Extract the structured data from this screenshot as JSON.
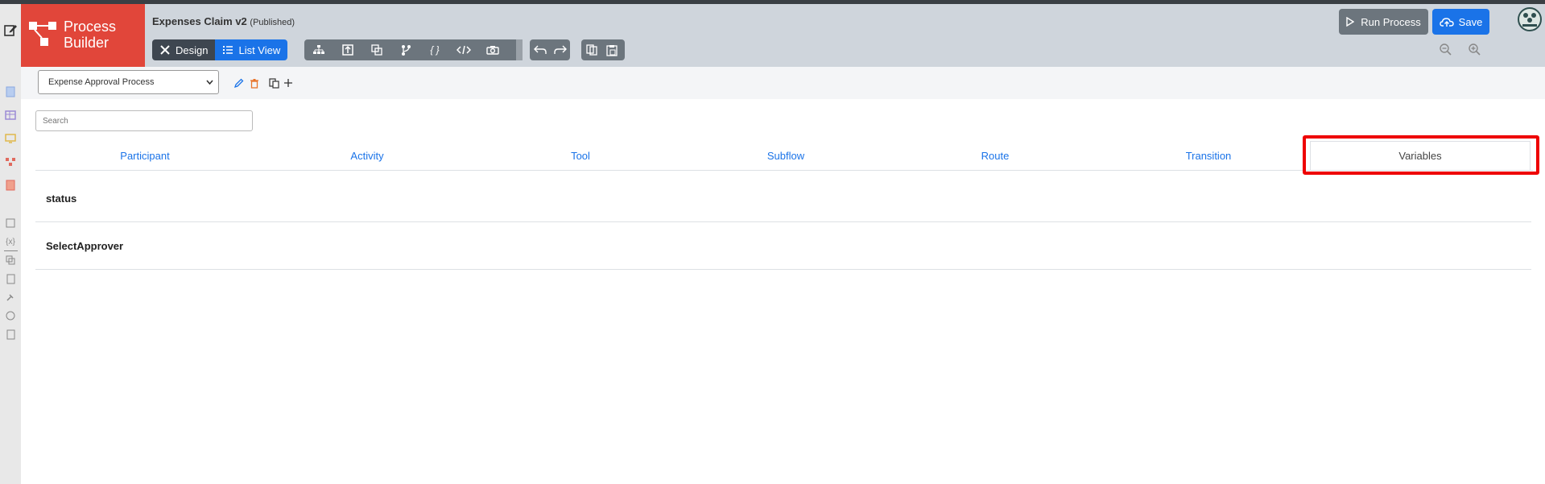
{
  "header": {
    "logo_line1": "Process",
    "logo_line2": "Builder",
    "title": "Expenses Claim v2",
    "status": "(Published)",
    "view_tabs": [
      {
        "label": "Design",
        "icon": "design-icon"
      },
      {
        "label": "List View",
        "icon": "list-icon"
      }
    ],
    "run_label": "Run Process",
    "save_label": "Save",
    "tools": [
      "org-chart-icon",
      "swimlane-icon",
      "participant-icon",
      "branch-icon",
      "variables-icon",
      "code-icon",
      "camera-icon"
    ],
    "history_tools": [
      "undo-icon",
      "redo-icon"
    ],
    "clipboard_tools": [
      "copy-icon",
      "paste-icon"
    ]
  },
  "subbar": {
    "process_selected": "Expense Approval Process"
  },
  "search": {
    "placeholder": "Search"
  },
  "tabs": [
    {
      "label": "Participant"
    },
    {
      "label": "Activity"
    },
    {
      "label": "Tool"
    },
    {
      "label": "Subflow"
    },
    {
      "label": "Route"
    },
    {
      "label": "Transition"
    },
    {
      "label": "Variables",
      "active": true
    }
  ],
  "variables": [
    {
      "name": "status"
    },
    {
      "name": "SelectApprover"
    }
  ],
  "colors": {
    "brand": "#e1463a",
    "accent": "#1a73e8",
    "highlight": "#ee0000"
  }
}
